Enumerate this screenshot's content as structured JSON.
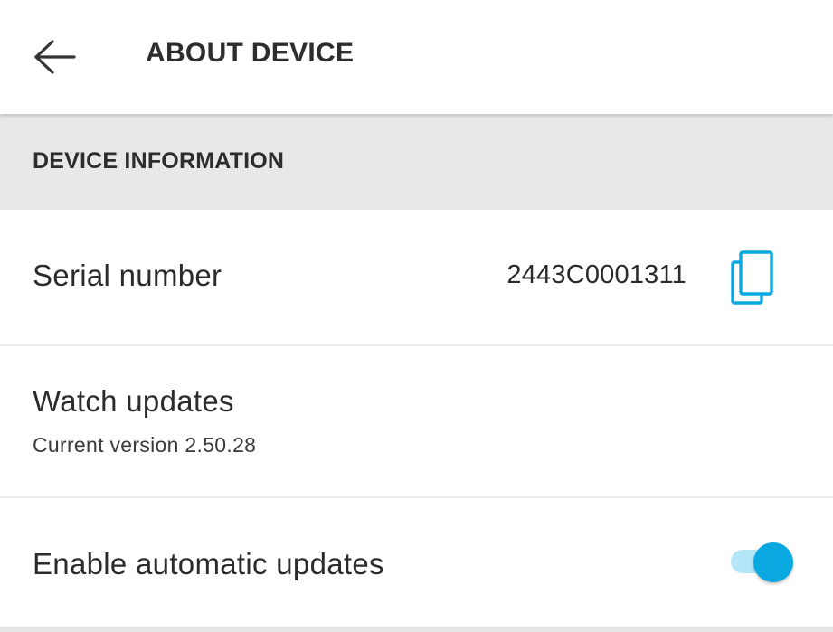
{
  "header": {
    "back_icon": "arrow-left-icon",
    "title": "ABOUT DEVICE"
  },
  "section": {
    "title": "DEVICE INFORMATION"
  },
  "serial": {
    "label": "Serial number",
    "value": "2443C0001311",
    "copy_icon": "copy-icon"
  },
  "updates": {
    "label": "Watch updates",
    "current_version": "Current version 2.50.28"
  },
  "auto_updates": {
    "label": "Enable automatic updates",
    "enabled": true
  },
  "colors": {
    "accent": "#0aa8e0",
    "accent_light": "#b4e6f8",
    "section_bg": "#e8e8e8",
    "text": "#2b2b2b"
  }
}
